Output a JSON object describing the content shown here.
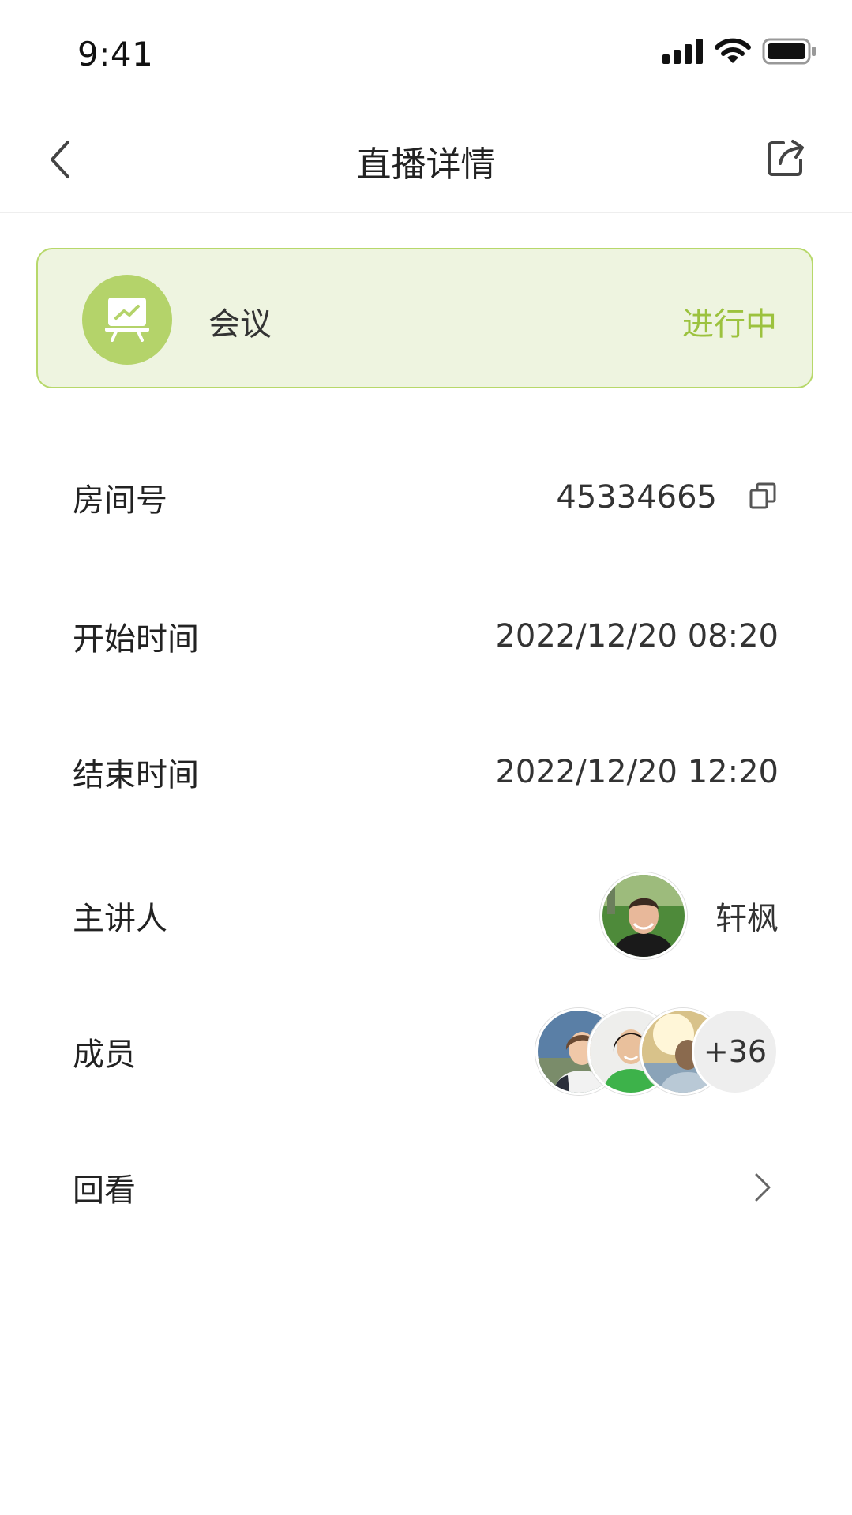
{
  "status_bar": {
    "time": "9:41",
    "icons": [
      "signal-icon",
      "wifi-icon",
      "battery-icon"
    ]
  },
  "nav": {
    "title": "直播详情",
    "back_icon": "chevron-left-icon",
    "share_icon": "share-icon"
  },
  "meeting": {
    "type": "会议",
    "status": "进行中",
    "icon": "presentation-board-icon",
    "colors": {
      "card_bg": "#eef4e0",
      "card_border": "#b7d86a",
      "icon_bg": "#b4d36a",
      "status_text": "#9cc23e"
    }
  },
  "details": {
    "room": {
      "label": "房间号",
      "value": "45334665",
      "copy_icon": "copy-icon"
    },
    "start": {
      "label": "开始时间",
      "value": "2022/12/20 08:20"
    },
    "end": {
      "label": "结束时间",
      "value": "2022/12/20 12:20"
    },
    "host": {
      "label": "主讲人",
      "name": "轩枫"
    },
    "members": {
      "label": "成员",
      "more": "+36"
    },
    "replay": {
      "label": "回看",
      "chevron_icon": "chevron-right-icon"
    }
  }
}
